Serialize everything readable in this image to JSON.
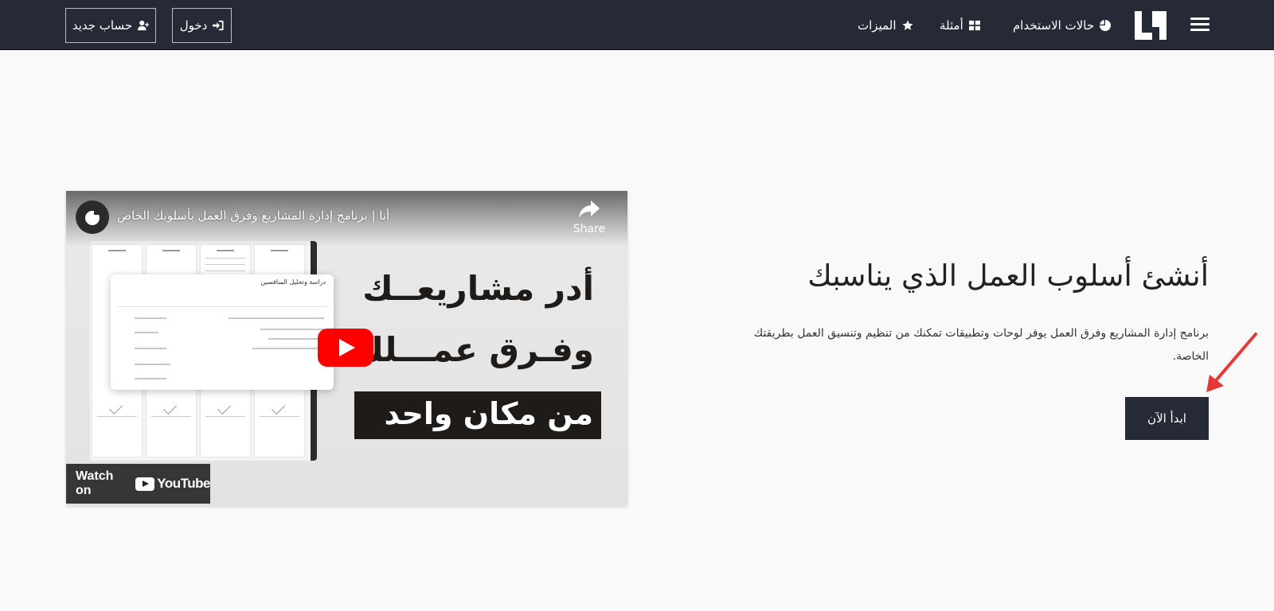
{
  "nav": {
    "items": [
      {
        "label": "حالات الاستخدام",
        "icon": "pie-chart-icon"
      },
      {
        "label": "أمثلة",
        "icon": "grid-icon"
      },
      {
        "label": "الميزات",
        "icon": "star-icon"
      }
    ],
    "login_label": "دخول",
    "signup_label": "حساب جديد"
  },
  "hero": {
    "title": "أنشئ أسلوب العمل الذي يناسبك",
    "description": "برنامج إدارة المشاريع وفرق العمل يوفر لوحات وتطبيقات تمكنك من تنظيم وتنسيق العمل بطريقتك الخاصة.",
    "cta_label": "ابدأ الآن"
  },
  "video": {
    "title": "أنا | برنامج إدارة المشاريع وفرق العمل بأسلوبك الخاص",
    "share_label": "Share",
    "overlay_line1": "أدر مشاريعــك",
    "overlay_line2": "وفـرق عمـــلك",
    "overlay_line3": "من مكان واحد",
    "modal_title": "دراسة وتحليل المنافسين",
    "watch_on_label": "Watch on",
    "youtube_label": "YouTube"
  },
  "colors": {
    "navbar": "#262a37",
    "cta": "#262a37",
    "arrow": "#e53935",
    "play": "#ff0000"
  }
}
